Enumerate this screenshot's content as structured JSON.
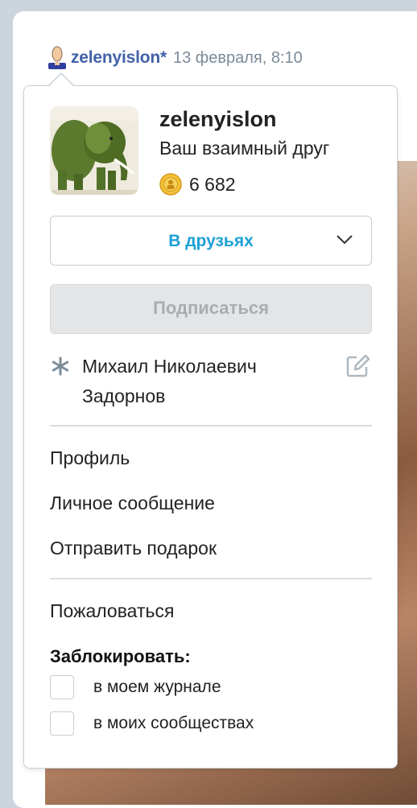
{
  "post_header": {
    "username": "zelenyislon*",
    "date": "13 февраля, 8:10"
  },
  "profile_popup": {
    "name": "zelenyislon",
    "relationship": "Ваш взаимный друг",
    "coins": "6 682",
    "friends_button": "В друзьях",
    "subscribe_button": "Подписаться",
    "note": "Михаил Николаевич Задорнов",
    "menu": {
      "profile": "Профиль",
      "message": "Личное сообщение",
      "gift": "Отправить подарок",
      "report": "Пожаловаться"
    },
    "block": {
      "title": "Заблокировать:",
      "options": [
        "в моем журнале",
        "в моих сообществах"
      ]
    }
  },
  "colors": {
    "username": "#4162a8",
    "friends_button_text": "#1da0d6",
    "subscribe_disabled_bg": "#e4e5e6",
    "border": "#c6d0d7"
  },
  "icons": {
    "user": "user-icon",
    "coin": "coin-icon",
    "chevron": "chevron-down-icon",
    "note": "asterisk-icon",
    "edit": "edit-icon"
  }
}
